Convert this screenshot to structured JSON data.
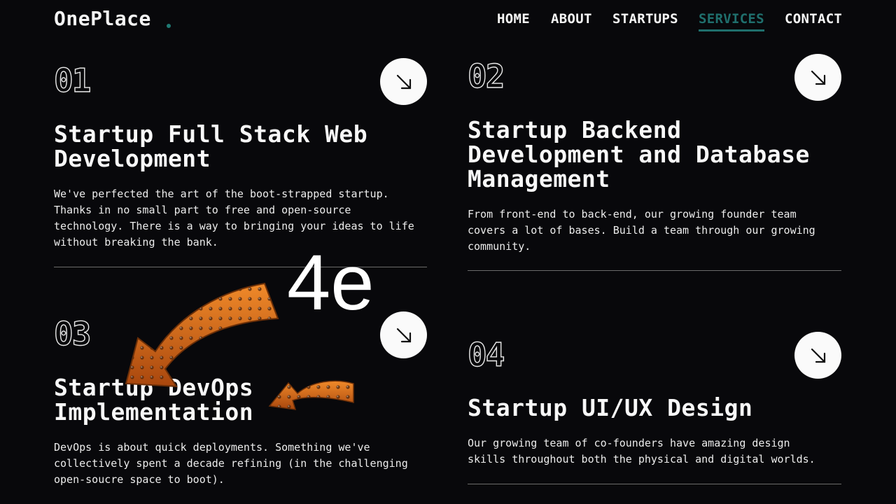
{
  "header": {
    "logo": "OnePlace",
    "nav": [
      {
        "label": "HOME",
        "active": false
      },
      {
        "label": "ABOUT",
        "active": false
      },
      {
        "label": "STARTUPS",
        "active": false
      },
      {
        "label": "SERVICES",
        "active": true
      },
      {
        "label": "CONTACT",
        "active": false
      }
    ]
  },
  "services": [
    {
      "number": "01",
      "title_lines": [
        "Startup Full Stack Web",
        "Development"
      ],
      "description_lines": [
        "We've perfected the art of the boot-strapped startup.",
        "Thanks in no small part to free and open-source",
        "technology. There is a way to bringing your ideas to life",
        "without breaking the bank."
      ],
      "button_icon": "arrow-down-right-icon"
    },
    {
      "number": "02",
      "title_lines": [
        "Startup Backend",
        "Development and Database",
        "Management"
      ],
      "description_lines": [
        "From front-end to back-end, our growing founder team",
        "covers a lot of bases. Build a team through our growing",
        "community."
      ],
      "button_icon": "arrow-down-right-icon"
    },
    {
      "number": "03",
      "title_lines": [
        "Startup DevOps",
        "Implementation"
      ],
      "description_lines": [
        "DevOps is about quick deployments. Something we've",
        "collectively spent a decade refining (in the challenging",
        "open-soucre space to boot)."
      ],
      "button_icon": "arrow-down-right-icon"
    },
    {
      "number": "04",
      "title_lines": [
        "Startup UI/UX Design"
      ],
      "description_lines": [
        "Our growing team of co-founders have amazing design",
        "skills throughout both the physical and digital worlds."
      ],
      "button_icon": "arrow-down-right-icon"
    }
  ],
  "overlay": {
    "text": "4e",
    "decoration": "orange-marquee-arrow-icon"
  },
  "colors": {
    "background": "#08080b",
    "accent": "#1f6f6d",
    "text": "#f2f2f2",
    "divider": "#6b6b6b",
    "arrow_orange": "#d8691a"
  }
}
